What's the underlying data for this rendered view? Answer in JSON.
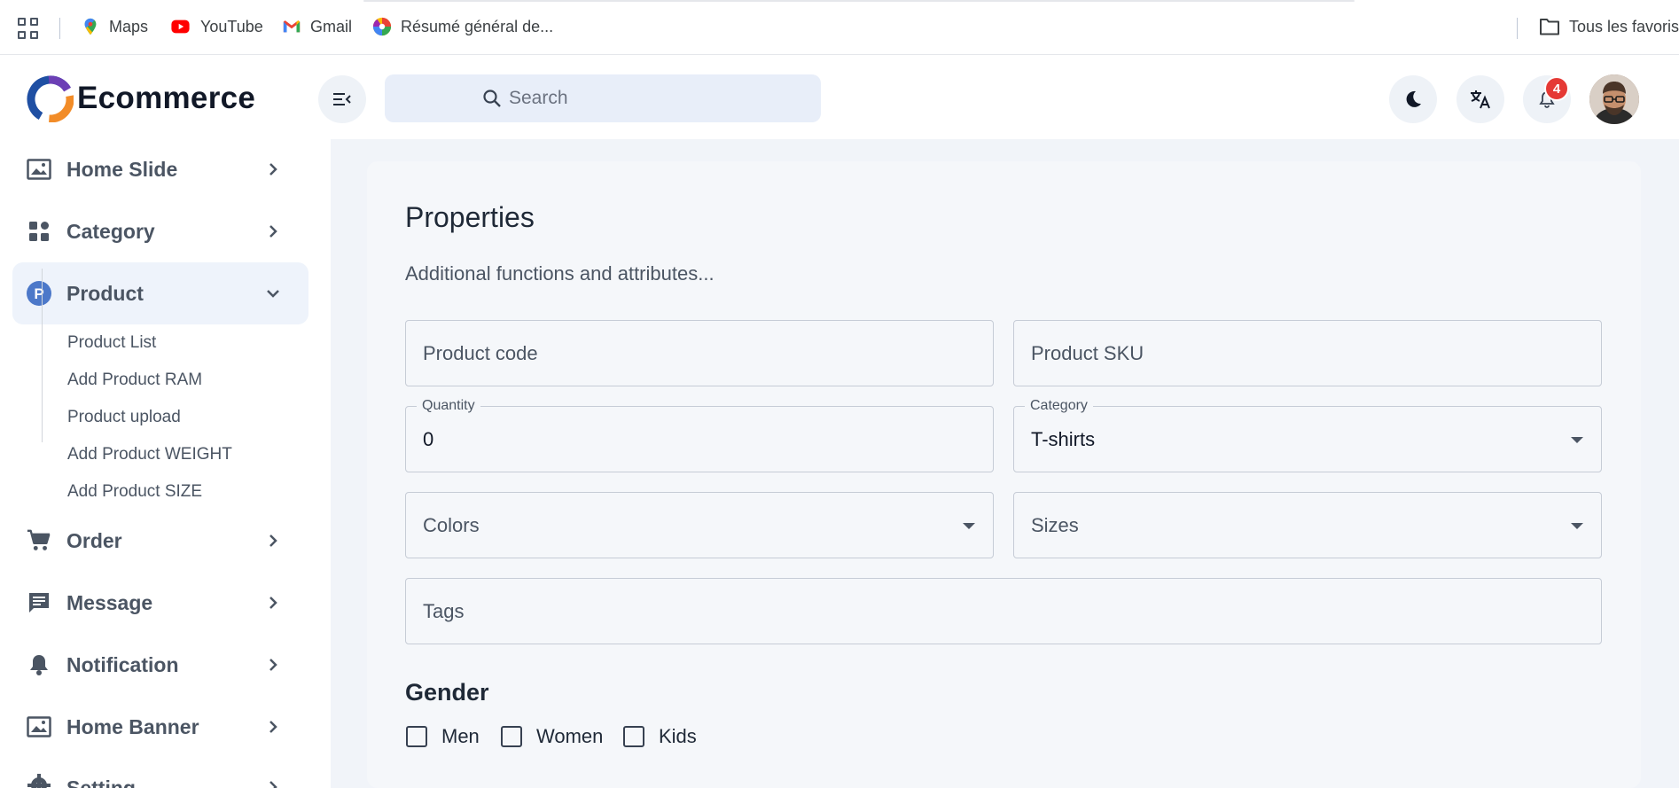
{
  "bookmarks": {
    "items": [
      {
        "label": "Maps",
        "icon": "maps-pin-icon"
      },
      {
        "label": "YouTube",
        "icon": "youtube-icon"
      },
      {
        "label": "Gmail",
        "icon": "gmail-icon"
      },
      {
        "label": "Résumé général de...",
        "icon": "color-wheel-icon"
      }
    ],
    "folder_label": "Tous les favoris"
  },
  "app": {
    "brand": "Ecommerce",
    "accent": "#4c78c9"
  },
  "sidebar": {
    "items": [
      {
        "label": "Home Slide",
        "icon": "image-icon"
      },
      {
        "label": "Category",
        "icon": "grid-icon"
      },
      {
        "label": "Product",
        "icon": "product-p-icon",
        "expanded": true
      },
      {
        "label": "Order",
        "icon": "cart-icon"
      },
      {
        "label": "Message",
        "icon": "message-icon"
      },
      {
        "label": "Notification",
        "icon": "bell-icon"
      },
      {
        "label": "Home Banner",
        "icon": "image-icon"
      },
      {
        "label": "Setting",
        "icon": "gear-icon"
      }
    ],
    "product_submenu": [
      "Product List",
      "Add Product RAM",
      "Product upload",
      "Add Product WEIGHT",
      "Add Product SIZE"
    ]
  },
  "header": {
    "search_placeholder": "Search",
    "notification_count": "4"
  },
  "form": {
    "title": "Properties",
    "subtitle": "Additional functions and attributes...",
    "product_code_placeholder": "Product code",
    "product_sku_placeholder": "Product SKU",
    "quantity_label": "Quantity",
    "quantity_value": "0",
    "category_label": "Category",
    "category_value": "T-shirts",
    "colors_placeholder": "Colors",
    "sizes_placeholder": "Sizes",
    "tags_placeholder": "Tags",
    "gender_title": "Gender",
    "gender_options": [
      "Men",
      "Women",
      "Kids"
    ]
  }
}
